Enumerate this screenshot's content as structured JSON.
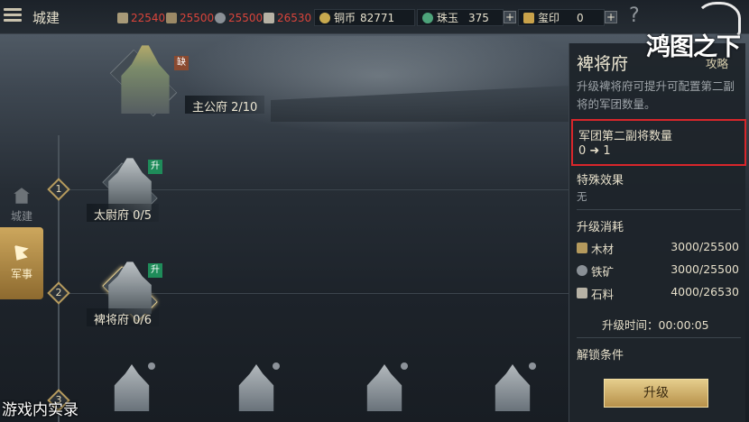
{
  "header": {
    "title": "城建",
    "resources": [
      {
        "icon": "food-icon",
        "value": "22540"
      },
      {
        "icon": "wood-icon",
        "value": "25500"
      },
      {
        "icon": "iron-icon",
        "value": "25500"
      },
      {
        "icon": "stone-icon",
        "value": "26530"
      }
    ],
    "currencies": [
      {
        "icon": "copper-coin-icon",
        "label": "铜币",
        "value": "82771"
      },
      {
        "icon": "jade-icon",
        "label": "珠玉",
        "value": "375"
      },
      {
        "icon": "seal-icon",
        "label": "玺印",
        "value": "0"
      }
    ],
    "help_label": "?"
  },
  "left_tabs": [
    {
      "label": "城建",
      "icon": "city-icon"
    },
    {
      "label": "军事",
      "icon": "flag-icon"
    }
  ],
  "tree": {
    "main_building": {
      "label": "主公府 2/10",
      "tag": "缺"
    },
    "tiers": [
      {
        "number": "1",
        "building": {
          "label": "太尉府 0/5",
          "tag": "升"
        }
      },
      {
        "number": "2",
        "building": {
          "label": "裨将府 0/6",
          "tag": "升"
        }
      },
      {
        "number": "3"
      }
    ]
  },
  "panel": {
    "title": "裨将府",
    "guide_link": "攻略",
    "description": "升级裨将府可提升可配置第二副将的军团数量。",
    "highlight": {
      "title": "军团第二副将数量",
      "value": "0 ➜ 1"
    },
    "special_title": "特殊效果",
    "special_value": "无",
    "cost_title": "升级消耗",
    "costs": [
      {
        "icon": "wood-icon",
        "name": "木材",
        "value": "3000/25500"
      },
      {
        "icon": "iron-icon",
        "name": "铁矿",
        "value": "3000/25500"
      },
      {
        "icon": "stone-icon",
        "name": "石料",
        "value": "4000/26530"
      }
    ],
    "time_label": "升级时间：00:00:05",
    "unlock_title": "解锁条件",
    "upgrade_button": "升级"
  },
  "logo_text": "鸿图之下",
  "watermark": "游戏内实录",
  "colors": {
    "accent_gold": "#cda75d",
    "highlight_border": "#d8262b",
    "resource_red": "#d9443b",
    "upgrade_tag_green": "#1f8c5a"
  }
}
